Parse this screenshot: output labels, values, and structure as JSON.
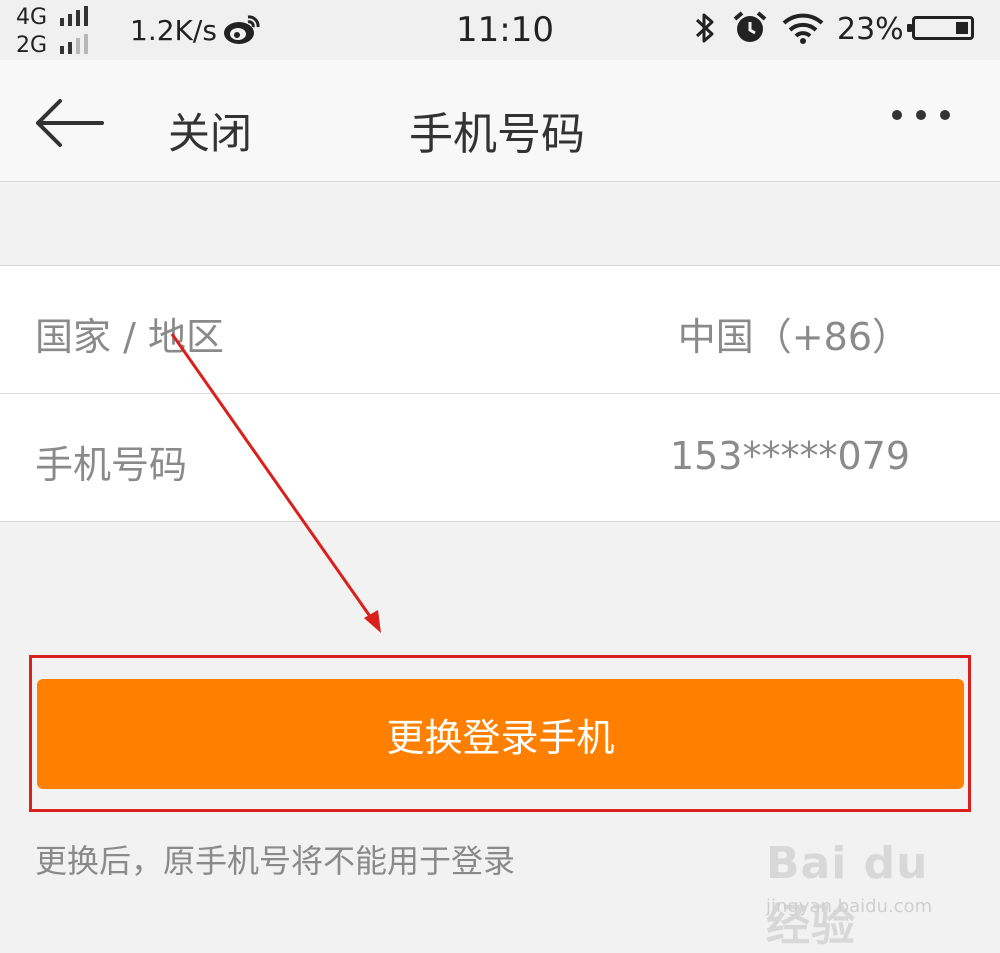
{
  "status_bar": {
    "network_top": "4G",
    "network_bottom": "2G",
    "speed": "1.2K/s",
    "time": "11:10",
    "battery_percent": "23%",
    "battery_level": 0.23,
    "icons": [
      "weibo-icon",
      "bluetooth-icon",
      "alarm-icon",
      "wifi-icon",
      "battery-icon"
    ]
  },
  "nav": {
    "back_icon": "back-arrow-icon",
    "close_label": "关闭",
    "title": "手机号码",
    "more_icon": "more-dots-icon"
  },
  "form": {
    "rows": [
      {
        "label": "国家 / 地区",
        "value": "中国（+86）"
      },
      {
        "label": "手机号码",
        "value": "153*****079"
      }
    ]
  },
  "action": {
    "button_label": "更换登录手机",
    "hint": "更换后，原手机号将不能用于登录"
  },
  "watermark": {
    "logo": "Bai du 经验",
    "url": "jingyan.baidu.com"
  },
  "colors": {
    "accent": "#ff8000",
    "annotation": "#d9201c",
    "background": "#f2f2f2"
  }
}
